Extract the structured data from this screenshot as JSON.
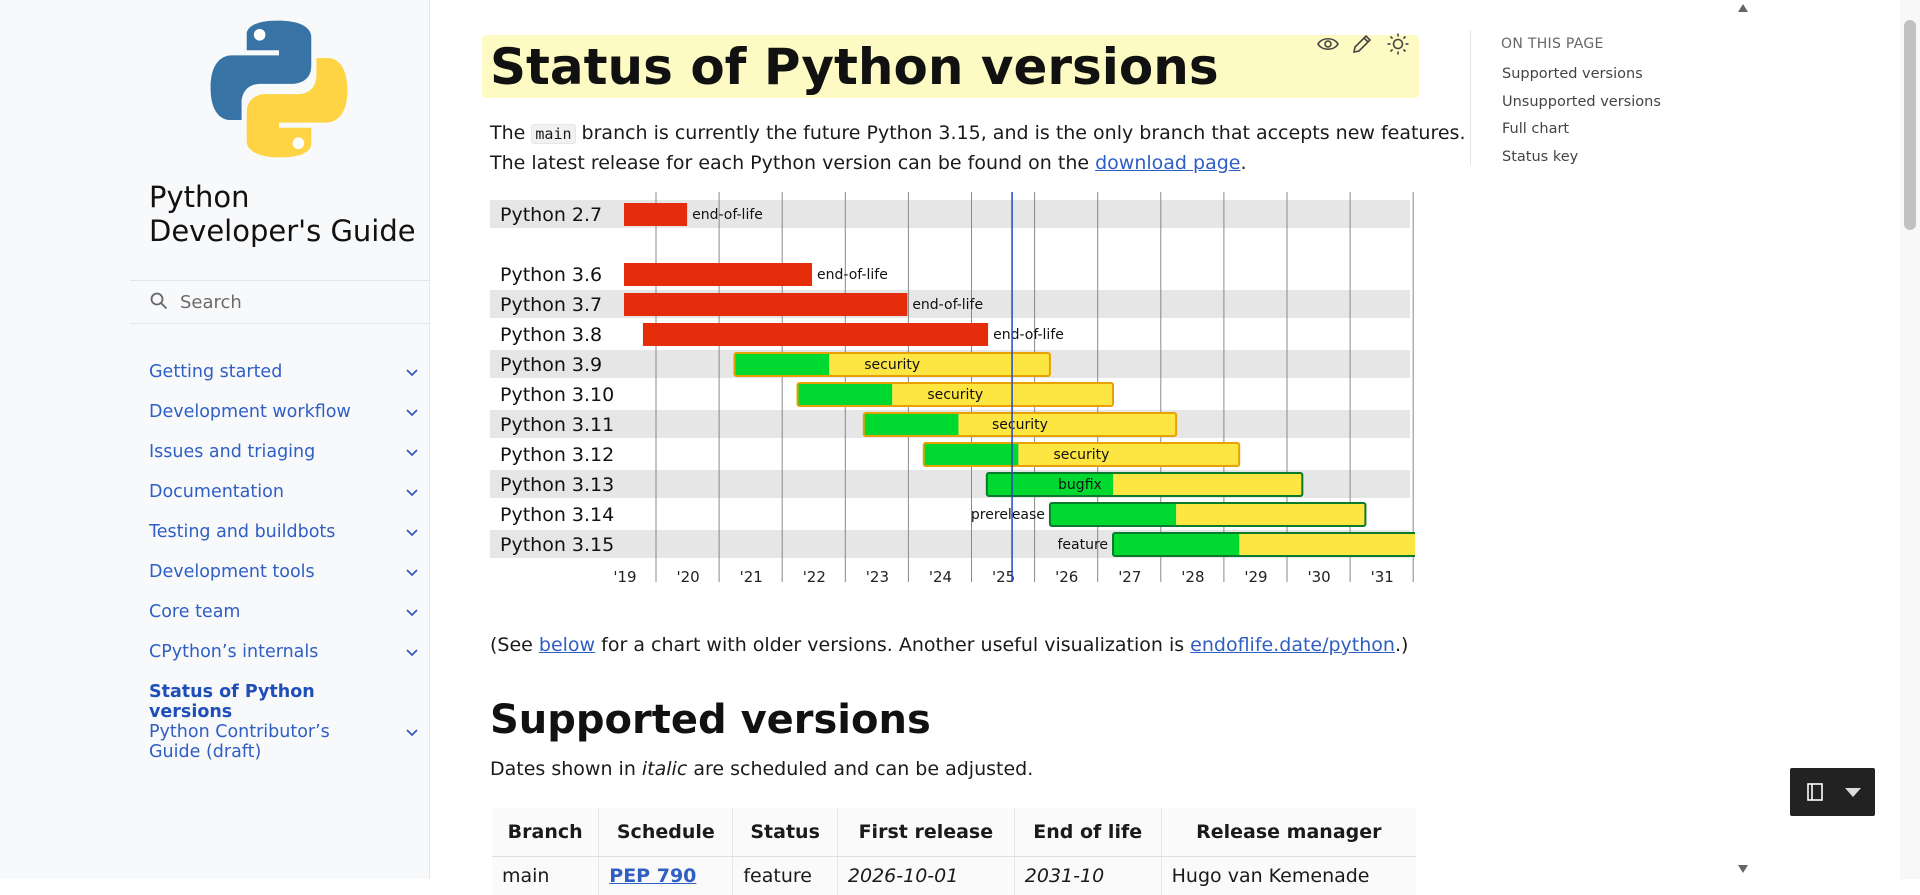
{
  "sidebar": {
    "site_title": "Python Developer's Guide",
    "search_placeholder": "Search",
    "items": [
      {
        "label": "Getting started",
        "expandable": true
      },
      {
        "label": "Development workflow",
        "expandable": true
      },
      {
        "label": "Issues and triaging",
        "expandable": true
      },
      {
        "label": "Documentation",
        "expandable": true
      },
      {
        "label": "Testing and buildbots",
        "expandable": true
      },
      {
        "label": "Development tools",
        "expandable": true
      },
      {
        "label": "Core team",
        "expandable": true
      },
      {
        "label": "CPython’s internals",
        "expandable": true
      },
      {
        "label": "Status of Python versions",
        "expandable": false,
        "active": true
      },
      {
        "label": "Python Contributor’s Guide (draft)",
        "expandable": true
      }
    ]
  },
  "main": {
    "title": "Status of Python versions",
    "intro": {
      "p1_pre": "The ",
      "p1_code": "main",
      "p1_post": " branch is currently the future Python 3.15, and is the only branch that accepts new features.",
      "p2_pre": "The latest release for each Python version can be found on the ",
      "p2_link": "download page",
      "p2_post": "."
    },
    "see_note": {
      "pre": "(See ",
      "link1": "below",
      "mid": " for a chart with older versions. Another useful visualization is ",
      "link2": "endoflife.date/python",
      "post": ".)"
    },
    "supported_heading": "Supported versions",
    "italic_note": {
      "pre": "Dates shown in ",
      "italic": "italic",
      "post": " are scheduled and can be adjusted."
    },
    "table": {
      "headers": [
        "Branch",
        "Schedule",
        "Status",
        "First release",
        "End of life",
        "Release manager"
      ],
      "rows": [
        [
          "main",
          "PEP 790",
          "feature",
          "2026-10-01",
          "2031-10",
          "Hugo van Kemenade"
        ]
      ]
    }
  },
  "toc": {
    "title": "ON THIS PAGE",
    "items": [
      "Supported versions",
      "Unsupported versions",
      "Full chart",
      "Status key"
    ]
  },
  "colors": {
    "eol": "#e52c0b",
    "bugfix": "#00d92f",
    "security": "#fde542",
    "link": "#2f5ec4",
    "today": "#2448c4"
  },
  "chart_data": {
    "type": "gantt",
    "x_tick_labels": [
      "'19",
      "'20",
      "'21",
      "'22",
      "'23",
      "'24",
      "'25",
      "'26",
      "'27",
      "'28",
      "'29",
      "'30",
      "'31"
    ],
    "x_range": [
      2018.5,
      2031.5
    ],
    "today": 2025.15,
    "versions": [
      {
        "label": "Python 2.7",
        "start": 2019.0,
        "bugfix_end": null,
        "end": 2020.0,
        "status": "end-of-life"
      },
      {
        "label": "Python 3.6",
        "start": 2019.0,
        "bugfix_end": null,
        "end": 2021.98,
        "status": "end-of-life"
      },
      {
        "label": "Python 3.7",
        "start": 2019.0,
        "bugfix_end": null,
        "end": 2023.49,
        "status": "end-of-life"
      },
      {
        "label": "Python 3.8",
        "start": 2019.3,
        "bugfix_end": null,
        "end": 2024.77,
        "status": "end-of-life"
      },
      {
        "label": "Python 3.9",
        "start": 2020.75,
        "bugfix_end": 2022.25,
        "end": 2025.75,
        "status": "security"
      },
      {
        "label": "Python 3.10",
        "start": 2021.75,
        "bugfix_end": 2023.25,
        "end": 2026.75,
        "status": "security"
      },
      {
        "label": "Python 3.11",
        "start": 2022.8,
        "bugfix_end": 2024.3,
        "end": 2027.75,
        "status": "security"
      },
      {
        "label": "Python 3.12",
        "start": 2023.75,
        "bugfix_end": 2025.25,
        "end": 2028.75,
        "status": "security"
      },
      {
        "label": "Python 3.13",
        "start": 2024.75,
        "bugfix_end": 2026.75,
        "end": 2029.75,
        "status": "bugfix"
      },
      {
        "label": "Python 3.14",
        "start": 2025.75,
        "bugfix_end": 2027.75,
        "end": 2030.75,
        "status": "prerelease"
      },
      {
        "label": "Python 3.15",
        "start": 2026.75,
        "bugfix_end": 2028.75,
        "end": 2031.75,
        "status": "feature"
      }
    ]
  }
}
